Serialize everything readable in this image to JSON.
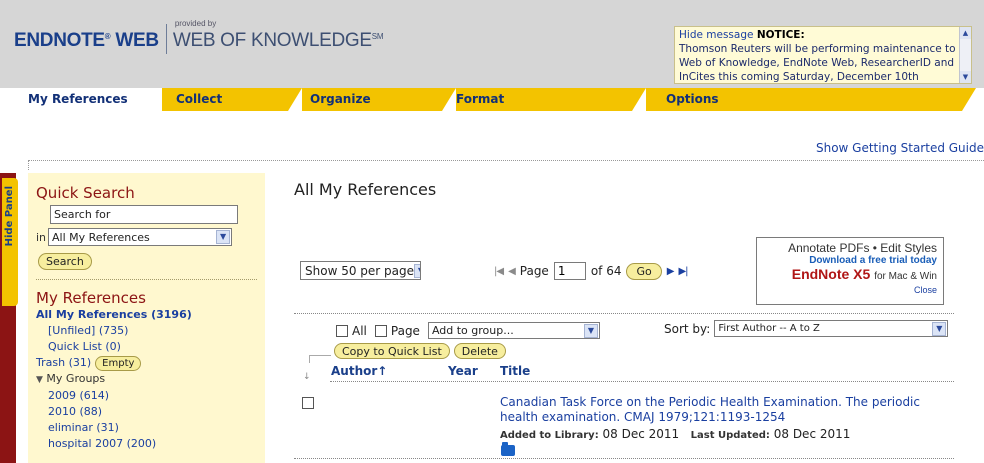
{
  "header": {
    "logo_endnote": "ENDNOTE",
    "logo_endnote_suffix": "WEB",
    "logo_provided_by": "provided by",
    "logo_wok": "WEB OF KNOWLEDGE",
    "logo_sm": "SM",
    "notice": {
      "hide_link": "Hide message",
      "label": "NOTICE:",
      "text": "Thomson Reuters will be performing maintenance to Web of Knowledge, EndNote Web, ResearcherID and InCites this coming Saturday, December 10th"
    }
  },
  "tabs": [
    "My References",
    "Collect",
    "Organize",
    "Format",
    "Options"
  ],
  "getting_started_link": "Show Getting Started Guide",
  "hide_panel_label": "Hide Panel",
  "sidebar": {
    "quick_search_title": "Quick Search",
    "search_value": "Search for",
    "in_label": "in",
    "scope_selected": "All My References",
    "search_button": "Search",
    "my_references_title": "My References",
    "all_refs": "All My References (3196)",
    "unfiled": "[Unfiled] (735)",
    "quick_list": "Quick List (0)",
    "trash": "Trash (31)",
    "empty_button": "Empty",
    "my_groups": "My Groups",
    "groups": [
      "2009 (614)",
      "2010 (88)",
      "eliminar (31)",
      "hospital 2007 (200)"
    ]
  },
  "main": {
    "title": "All My References",
    "per_page_selected": "Show 50 per page",
    "page_label": "Page",
    "page_value": "1",
    "of_label": "of 64",
    "go_button": "Go",
    "ad": {
      "line1": "Annotate PDFs • Edit Styles",
      "line2": "Download a free trial today",
      "product": "EndNote X5",
      "platform": "for Mac & Win",
      "close": "Close"
    },
    "select_all_label": "All",
    "select_page_label": "Page",
    "add_to_group_selected": "Add to group...",
    "sort_label": "Sort by:",
    "sort_selected": "First Author -- A to Z",
    "copy_button": "Copy to Quick List",
    "delete_button": "Delete",
    "columns": {
      "author": "Author",
      "year": "Year",
      "title": "Title"
    },
    "reference": {
      "title": "Canadian Task Force on the Periodic Health Examination. The periodic health examination. CMAJ 1979;121:1193-1254",
      "added_label": "Added to Library:",
      "added_date": "08 Dec 2011",
      "updated_label": "Last Updated:",
      "updated_date": "08 Dec 2011"
    }
  }
}
